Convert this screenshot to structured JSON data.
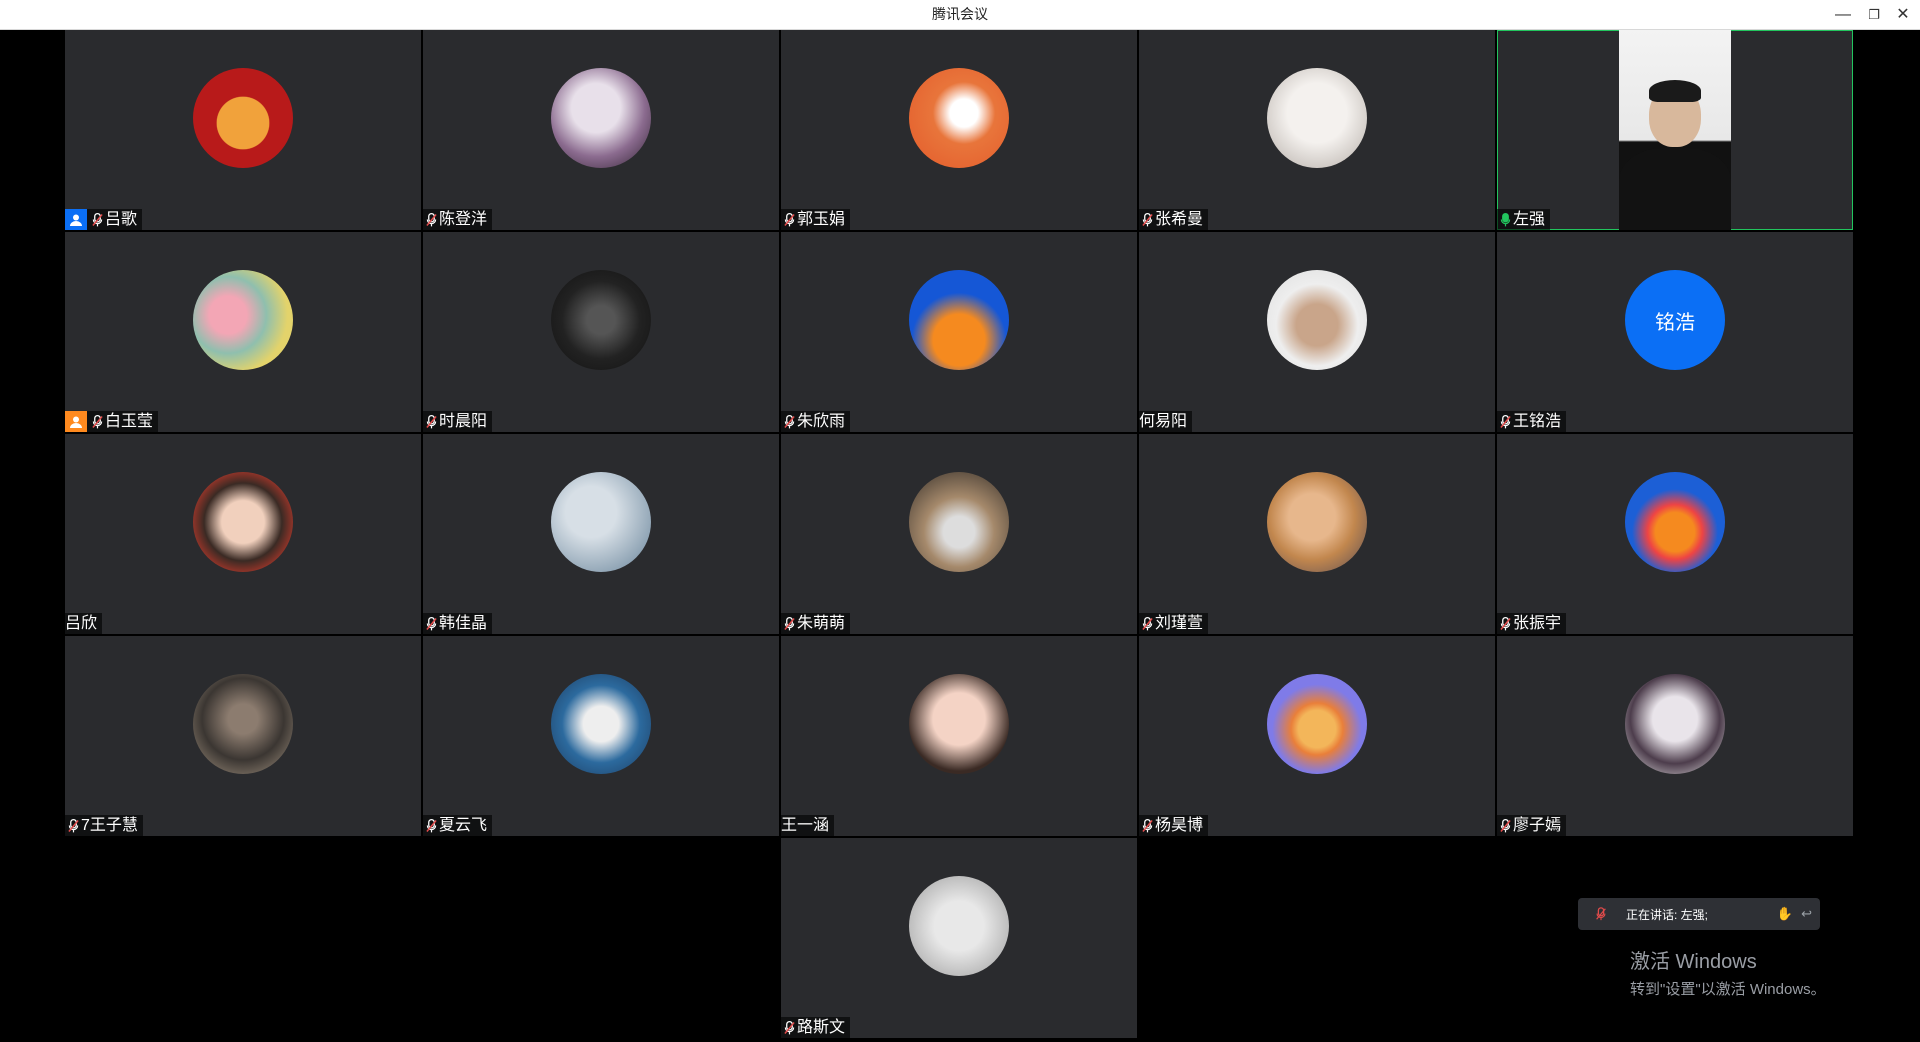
{
  "window": {
    "title": "腾讯会议",
    "controls": {
      "minimize": "—",
      "maximize": "❐",
      "close": "✕"
    }
  },
  "participants": [
    {
      "name": "吕歌",
      "host_badge": "blue",
      "mic": "muted",
      "avatar_icon": "tiger-avatar-icon"
    },
    {
      "name": "陈登洋",
      "mic": "muted",
      "avatar_icon": "anime-girl-avatar-icon"
    },
    {
      "name": "郭玉娟",
      "mic": "muted",
      "avatar_icon": "cartoon-boy-avatar-icon"
    },
    {
      "name": "张希曼",
      "mic": "muted",
      "avatar_icon": "illustrated-woman-avatar-icon"
    },
    {
      "name": "左强",
      "mic": "active",
      "video": true,
      "avatar_icon": "camera-video-icon"
    },
    {
      "name": "白玉莹",
      "host_badge": "orange",
      "mic": "muted",
      "avatar_icon": "cartoon-patrick-spongebob-avatar-icon"
    },
    {
      "name": "时晨阳",
      "mic": "muted",
      "avatar_icon": "dark-photo-avatar-icon"
    },
    {
      "name": "朱欣雨",
      "mic": "muted",
      "avatar_icon": "cartoon-character-avatar-icon"
    },
    {
      "name": "何易阳",
      "mic": "none",
      "avatar_icon": "masked-man-avatar-icon"
    },
    {
      "name": "王铭浩",
      "mic": "muted",
      "avatar_text": "铭浩"
    },
    {
      "name": "吕欣",
      "mic": "none",
      "avatar_icon": "woman-photo-avatar-icon"
    },
    {
      "name": "韩佳晶",
      "mic": "muted",
      "avatar_icon": "cloudy-sky-avatar-icon"
    },
    {
      "name": "朱萌萌",
      "mic": "muted",
      "avatar_icon": "cats-avatar-icon"
    },
    {
      "name": "刘瑾萱",
      "mic": "muted",
      "avatar_icon": "hand-photo-avatar-icon"
    },
    {
      "name": "张振宇",
      "mic": "muted",
      "avatar_icon": "cartoon-boy-blue-avatar-icon"
    },
    {
      "name": "7王子慧",
      "mic": "muted",
      "avatar_icon": "dark-portrait-avatar-icon"
    },
    {
      "name": "夏云飞",
      "mic": "muted",
      "avatar_icon": "football-player-avatar-icon"
    },
    {
      "name": "王一涵",
      "mic": "none",
      "avatar_icon": "girl-selfie-avatar-icon"
    },
    {
      "name": "杨昊博",
      "mic": "muted",
      "avatar_icon": "illustrated-man-avatar-icon"
    },
    {
      "name": "廖子嫣",
      "mic": "muted",
      "avatar_icon": "gothic-art-avatar-icon"
    },
    {
      "name": "路斯文",
      "mic": "muted",
      "avatar_icon": "street-photo-avatar-icon"
    }
  ],
  "speaking_notice": {
    "text": "正在讲话: 左强;",
    "icons": [
      "mic-muted-icon",
      "hands-icon",
      "reply-icon"
    ]
  },
  "watermark": {
    "line1": "激活 Windows",
    "line2": "转到\"设置\"以激活 Windows。"
  },
  "colors": {
    "tile_bg": "#2a2b2e",
    "active_speaker_border": "#22c55e",
    "host_blue": "#0b6ff5",
    "host_orange": "#ff8a1f",
    "muted_mic": "#e24b4b",
    "active_mic": "#22c55e"
  }
}
